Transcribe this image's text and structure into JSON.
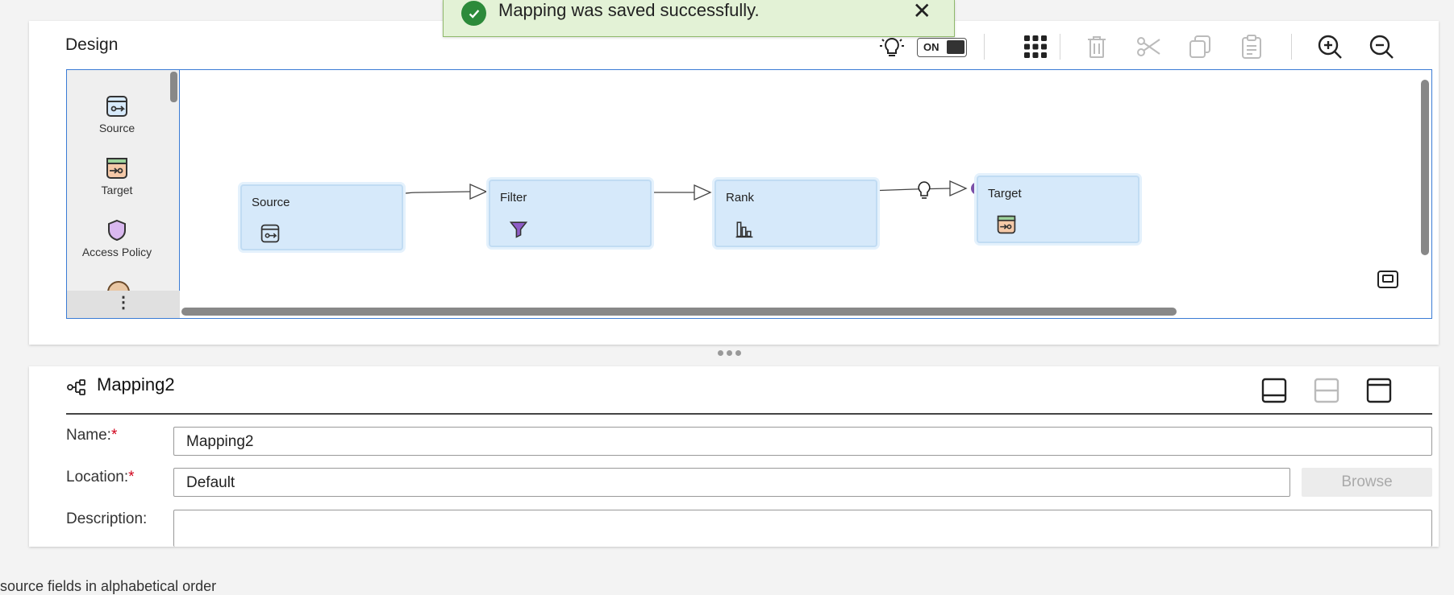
{
  "toast": {
    "message": "Mapping was saved successfully.",
    "close_glyph": "✕",
    "check_icon": "check-circle-icon",
    "bg_color": "#e3f2d6"
  },
  "design": {
    "title": "Design",
    "toggle_label": "ON",
    "toolbar": [
      "lightbulb-icon",
      "toggle",
      "grid-icon",
      "trash-icon",
      "scissors-icon",
      "copy-icon",
      "paste-icon",
      "zoom-in-icon",
      "zoom-out-icon"
    ],
    "palette": {
      "items": [
        {
          "label": "Source",
          "icon": "source-icon"
        },
        {
          "label": "Target",
          "icon": "target-icon"
        },
        {
          "label": "Access Policy",
          "icon": "shield-icon"
        }
      ],
      "more_glyph": "⋮"
    },
    "nodes": [
      {
        "label": "Source",
        "icon": "source-icon"
      },
      {
        "label": "Filter",
        "icon": "filter-icon"
      },
      {
        "label": "Rank",
        "icon": "rank-icon"
      },
      {
        "label": "Target",
        "icon": "target-icon"
      }
    ],
    "accent_color": "#7b4fa8"
  },
  "properties": {
    "title": "Mapping2",
    "fields": {
      "name_label": "Name:",
      "name_value": "Mapping2",
      "location_label": "Location:",
      "location_value": "Default",
      "description_label": "Description:",
      "description_value": "",
      "required_mark": "*"
    },
    "browse_label": "Browse"
  },
  "footer_text": "source fields in alphabetical order"
}
